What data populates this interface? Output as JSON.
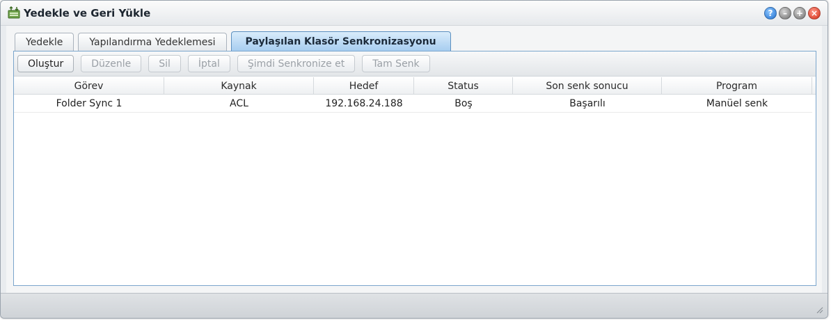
{
  "window": {
    "title": "Yedekle ve Geri Yükle",
    "app_icon": "backup-restore-icon",
    "buttons": [
      "help-icon",
      "minimize-icon",
      "maximize-icon",
      "close-icon"
    ]
  },
  "tabs": [
    {
      "label": "Yedekle",
      "active": false
    },
    {
      "label": "Yapılandırma Yedeklemesi",
      "active": false
    },
    {
      "label": "Paylaşılan Klasör Senkronizasyonu",
      "active": true
    }
  ],
  "toolbar": {
    "create": "Oluştur",
    "edit": "Düzenle",
    "delete": "Sil",
    "cancel": "İptal",
    "sync_now": "Şimdi Senkronize et",
    "full_sync": "Tam Senk"
  },
  "table": {
    "columns": [
      "Görev",
      "Kaynak",
      "Hedef",
      "Status",
      "Son senk sonucu",
      "Program"
    ],
    "rows": [
      [
        "Folder Sync 1",
        "ACL",
        "192.168.24.188",
        "Boş",
        "Başarılı",
        "Manüel senk"
      ]
    ]
  },
  "colors": {
    "active_tab": "#a7cdf0",
    "panel_border": "#7aa5cc",
    "close_button": "#d32a14",
    "help_button": "#1f6fcf"
  }
}
